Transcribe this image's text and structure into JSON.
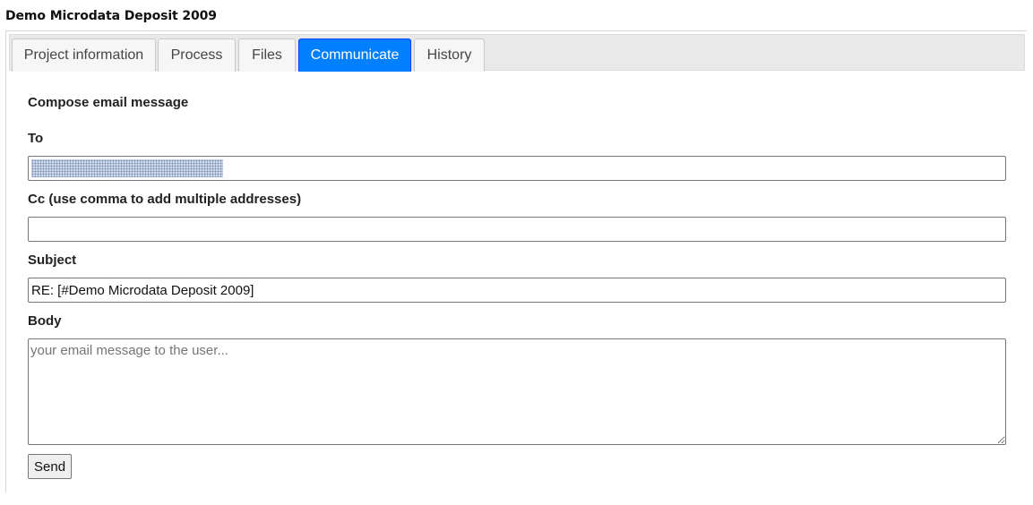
{
  "page": {
    "title": "Demo Microdata Deposit 2009"
  },
  "tabs": [
    {
      "label": "Project information",
      "active": false
    },
    {
      "label": "Process",
      "active": false
    },
    {
      "label": "Files",
      "active": false
    },
    {
      "label": "Communicate",
      "active": true
    },
    {
      "label": "History",
      "active": false
    }
  ],
  "compose": {
    "heading": "Compose email message",
    "to_label": "To",
    "to_value": "",
    "cc_label": "Cc (use comma to add multiple addresses)",
    "cc_value": "",
    "subject_label": "Subject",
    "subject_value": "RE: [#Demo Microdata Deposit 2009]",
    "body_label": "Body",
    "body_placeholder": "your email message to the user...",
    "send_label": "Send"
  },
  "colors": {
    "active_tab": "#007fff",
    "tabbar_background": "#e9e9e9"
  }
}
